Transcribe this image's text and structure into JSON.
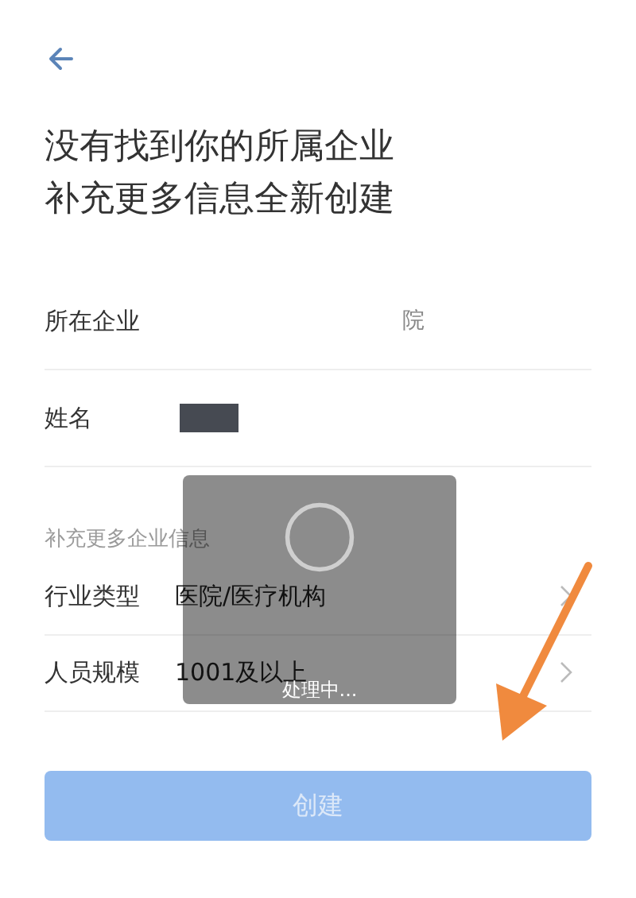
{
  "heading_lines": [
    "没有找到你的所属企业",
    "补充更多信息全新创建"
  ],
  "fields": [
    {
      "kind": "text",
      "label": "所在企业",
      "value": "院"
    },
    {
      "kind": "redacted",
      "label": "姓名"
    }
  ],
  "section_label": "补充更多企业信息",
  "options": [
    {
      "label": "行业类型",
      "value": "医院/医疗机构"
    },
    {
      "label": "人员规模",
      "value": "1001及以上"
    }
  ],
  "create_button": {
    "label": "创建",
    "disabled": true
  },
  "toast": {
    "text": "处理中..."
  }
}
